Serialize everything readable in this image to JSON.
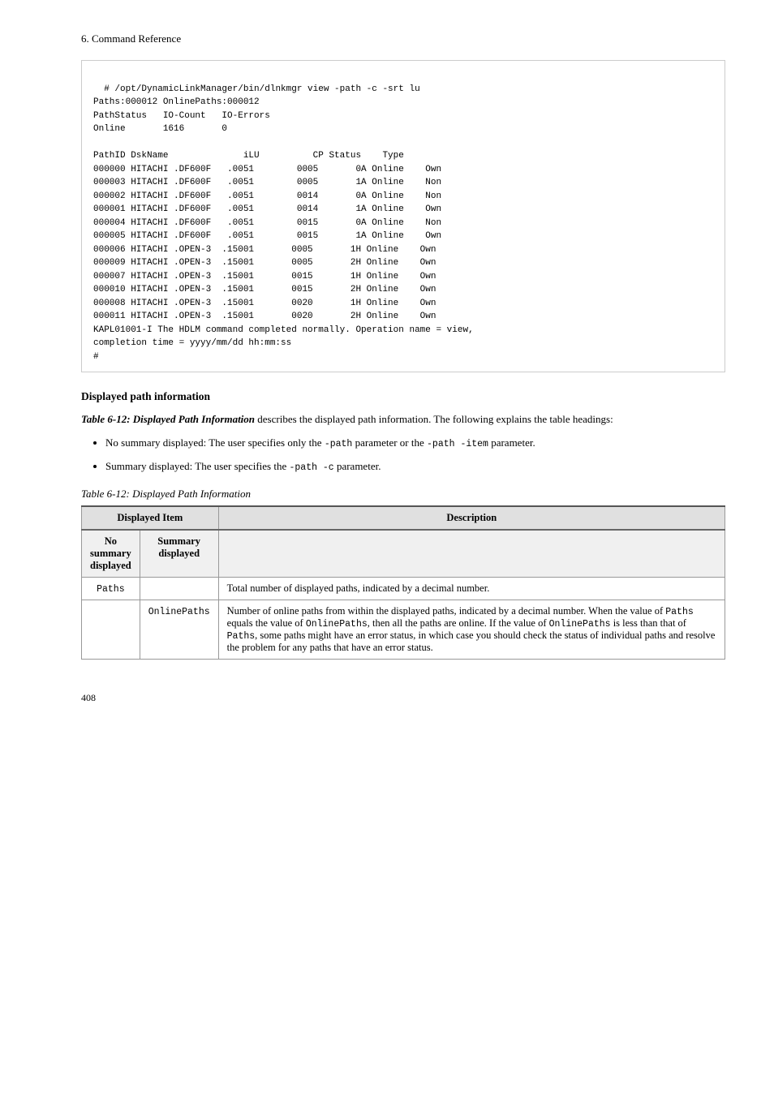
{
  "header": {
    "text": "6.  Command Reference"
  },
  "code_block": {
    "content": "# /opt/DynamicLinkManager/bin/dlnkmgr view -path -c -srt lu\nPaths:000012 OnlinePaths:000012\nPathStatus   IO-Count   IO-Errors\nOnline       1616       0\n\nPathID DskName              iLU          CP Status    Type\n000000 HITACHI .DF600F   .0051        0005       0A Online    Own\n000003 HITACHI .DF600F   .0051        0005       1A Online    Non\n000002 HITACHI .DF600F   .0051        0014       0A Online    Non\n000001 HITACHI .DF600F   .0051        0014       1A Online    Own\n000004 HITACHI .DF600F   .0051        0015       0A Online    Non\n000005 HITACHI .DF600F   .0051        0015       1A Online    Own\n000006 HITACHI .OPEN-3  .15001       0005       1H Online    Own\n000009 HITACHI .OPEN-3  .15001       0005       2H Online    Own\n000007 HITACHI .OPEN-3  .15001       0015       1H Online    Own\n000010 HITACHI .OPEN-3  .15001       0015       2H Online    Own\n000008 HITACHI .OPEN-3  .15001       0020       1H Online    Own\n000011 HITACHI .OPEN-3  .15001       0020       2H Online    Own\nKAPL01001-I The HDLM command completed normally. Operation name = view,\ncompletion time = yyyy/mm/dd hh:mm:ss\n#"
  },
  "section": {
    "heading": "Displayed path information",
    "intro1": "Table  6-12:  Displayed Path Information describes the displayed path information. The following explains the table headings:",
    "bullet1": "No summary displayed: The user specifies only the ",
    "bullet1_code1": "-path",
    "bullet1_mid": " parameter or the ",
    "bullet1_code2": "-path -item",
    "bullet1_end": " parameter.",
    "bullet2": "Summary displayed: The user specifies the ",
    "bullet2_code": "-path -c",
    "bullet2_end": " parameter.",
    "table_caption": "Table  6-12:  Displayed Path Information"
  },
  "table": {
    "col1_header": "Displayed Item",
    "col2_header": "Description",
    "sub_col1": "No summary displayed",
    "sub_col2": "Summary displayed",
    "rows": [
      {
        "item": "Paths",
        "show_no_summary": true,
        "show_summary": true,
        "description": "Total number of displayed paths, indicated by a decimal number."
      },
      {
        "item": "OnlinePaths",
        "show_no_summary": false,
        "show_summary": true,
        "description": "Number of online paths from within the displayed paths, indicated by a decimal number. When the value of Paths equals the value of OnlinePaths, then all the paths are online. If the value of OnlinePaths is less than that of Paths, some paths might have an error status, in which case you should check the status of individual paths and resolve the problem for any paths that have an error status."
      }
    ]
  },
  "page_number": "408"
}
